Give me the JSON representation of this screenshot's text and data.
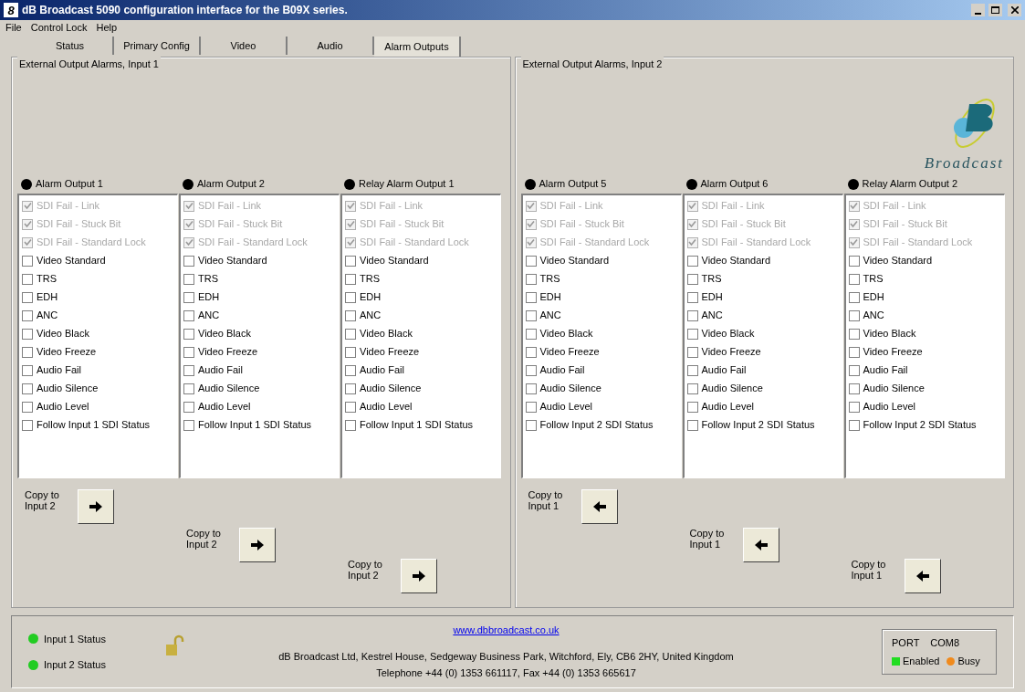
{
  "window": {
    "title": "dB Broadcast 5090 configuration interface for the B09X series.",
    "app_icon": "8"
  },
  "menu": [
    "File",
    "Control Lock",
    "Help"
  ],
  "tabs": [
    {
      "label": "Status",
      "selected": false
    },
    {
      "label": "Primary Config",
      "selected": false
    },
    {
      "label": "Video",
      "selected": false
    },
    {
      "label": "Audio",
      "selected": false
    },
    {
      "label": "Alarm Outputs",
      "selected": true
    }
  ],
  "panels": [
    {
      "title": "External Output Alarms, Input 1",
      "columns": [
        {
          "title": "Alarm Output 1",
          "copy": "Copy to Input 2",
          "items": [
            {
              "label": "SDI Fail - Link",
              "checked": true,
              "disabled": true
            },
            {
              "label": "SDI Fail - Stuck Bit",
              "checked": true,
              "disabled": true
            },
            {
              "label": "SDI Fail - Standard Lock",
              "checked": true,
              "disabled": true
            },
            {
              "label": "Video Standard",
              "checked": false,
              "disabled": false
            },
            {
              "label": "TRS",
              "checked": false,
              "disabled": false
            },
            {
              "label": "EDH",
              "checked": false,
              "disabled": false
            },
            {
              "label": "ANC",
              "checked": false,
              "disabled": false
            },
            {
              "label": "Video Black",
              "checked": false,
              "disabled": false
            },
            {
              "label": "Video Freeze",
              "checked": false,
              "disabled": false
            },
            {
              "label": "Audio Fail",
              "checked": false,
              "disabled": false
            },
            {
              "label": "Audio Silence",
              "checked": false,
              "disabled": false
            },
            {
              "label": "Audio Level",
              "checked": false,
              "disabled": false
            },
            {
              "label": "Follow Input 1 SDI Status",
              "checked": false,
              "disabled": false
            }
          ]
        },
        {
          "title": "Alarm Output 2",
          "copy": "Copy to Input 2",
          "items": [
            {
              "label": "SDI Fail - Link",
              "checked": true,
              "disabled": true
            },
            {
              "label": "SDI Fail - Stuck Bit",
              "checked": true,
              "disabled": true
            },
            {
              "label": "SDI Fail - Standard Lock",
              "checked": true,
              "disabled": true
            },
            {
              "label": "Video Standard",
              "checked": false,
              "disabled": false
            },
            {
              "label": "TRS",
              "checked": false,
              "disabled": false
            },
            {
              "label": "EDH",
              "checked": false,
              "disabled": false
            },
            {
              "label": "ANC",
              "checked": false,
              "disabled": false
            },
            {
              "label": "Video Black",
              "checked": false,
              "disabled": false
            },
            {
              "label": "Video Freeze",
              "checked": false,
              "disabled": false
            },
            {
              "label": "Audio Fail",
              "checked": false,
              "disabled": false
            },
            {
              "label": "Audio Silence",
              "checked": false,
              "disabled": false
            },
            {
              "label": "Audio Level",
              "checked": false,
              "disabled": false
            },
            {
              "label": "Follow Input 1 SDI Status",
              "checked": false,
              "disabled": false
            }
          ]
        },
        {
          "title": "Relay Alarm Output 1",
          "copy": "Copy to Input 2",
          "items": [
            {
              "label": "SDI Fail - Link",
              "checked": true,
              "disabled": true
            },
            {
              "label": "SDI Fail - Stuck Bit",
              "checked": true,
              "disabled": true
            },
            {
              "label": "SDI Fail - Standard Lock",
              "checked": true,
              "disabled": true
            },
            {
              "label": "Video Standard",
              "checked": false,
              "disabled": false
            },
            {
              "label": "TRS",
              "checked": false,
              "disabled": false
            },
            {
              "label": "EDH",
              "checked": false,
              "disabled": false
            },
            {
              "label": "ANC",
              "checked": false,
              "disabled": false
            },
            {
              "label": "Video Black",
              "checked": false,
              "disabled": false
            },
            {
              "label": "Video Freeze",
              "checked": false,
              "disabled": false
            },
            {
              "label": "Audio Fail",
              "checked": false,
              "disabled": false
            },
            {
              "label": "Audio Silence",
              "checked": false,
              "disabled": false
            },
            {
              "label": "Audio Level",
              "checked": false,
              "disabled": false
            },
            {
              "label": "Follow Input 1 SDI Status",
              "checked": false,
              "disabled": false
            }
          ]
        }
      ]
    },
    {
      "title": "External Output Alarms, Input 2",
      "logo_text": "Broadcast",
      "columns": [
        {
          "title": "Alarm Output 5",
          "copy": "Copy to Input 1",
          "items": [
            {
              "label": "SDI Fail - Link",
              "checked": true,
              "disabled": true
            },
            {
              "label": "SDI Fail - Stuck Bit",
              "checked": true,
              "disabled": true
            },
            {
              "label": "SDI Fail - Standard Lock",
              "checked": true,
              "disabled": true
            },
            {
              "label": "Video Standard",
              "checked": false,
              "disabled": false
            },
            {
              "label": "TRS",
              "checked": false,
              "disabled": false
            },
            {
              "label": "EDH",
              "checked": false,
              "disabled": false
            },
            {
              "label": "ANC",
              "checked": false,
              "disabled": false
            },
            {
              "label": "Video Black",
              "checked": false,
              "disabled": false
            },
            {
              "label": "Video Freeze",
              "checked": false,
              "disabled": false
            },
            {
              "label": "Audio Fail",
              "checked": false,
              "disabled": false
            },
            {
              "label": "Audio Silence",
              "checked": false,
              "disabled": false
            },
            {
              "label": "Audio Level",
              "checked": false,
              "disabled": false
            },
            {
              "label": "Follow Input 2 SDI Status",
              "checked": false,
              "disabled": false
            }
          ]
        },
        {
          "title": "Alarm Output 6",
          "copy": "Copy to Input 1",
          "items": [
            {
              "label": "SDI Fail - Link",
              "checked": true,
              "disabled": true
            },
            {
              "label": "SDI Fail - Stuck Bit",
              "checked": true,
              "disabled": true
            },
            {
              "label": "SDI Fail - Standard Lock",
              "checked": true,
              "disabled": true
            },
            {
              "label": "Video Standard",
              "checked": false,
              "disabled": false
            },
            {
              "label": "TRS",
              "checked": false,
              "disabled": false
            },
            {
              "label": "EDH",
              "checked": false,
              "disabled": false
            },
            {
              "label": "ANC",
              "checked": false,
              "disabled": false
            },
            {
              "label": "Video Black",
              "checked": false,
              "disabled": false
            },
            {
              "label": "Video Freeze",
              "checked": false,
              "disabled": false
            },
            {
              "label": "Audio Fail",
              "checked": false,
              "disabled": false
            },
            {
              "label": "Audio Silence",
              "checked": false,
              "disabled": false
            },
            {
              "label": "Audio Level",
              "checked": false,
              "disabled": false
            },
            {
              "label": "Follow Input 2 SDI Status",
              "checked": false,
              "disabled": false
            }
          ]
        },
        {
          "title": "Relay Alarm Output 2",
          "copy": "Copy to Input 1",
          "items": [
            {
              "label": "SDI Fail - Link",
              "checked": true,
              "disabled": true
            },
            {
              "label": "SDI Fail - Stuck Bit",
              "checked": true,
              "disabled": true
            },
            {
              "label": "SDI Fail - Standard Lock",
              "checked": true,
              "disabled": true
            },
            {
              "label": "Video Standard",
              "checked": false,
              "disabled": false
            },
            {
              "label": "TRS",
              "checked": false,
              "disabled": false
            },
            {
              "label": "EDH",
              "checked": false,
              "disabled": false
            },
            {
              "label": "ANC",
              "checked": false,
              "disabled": false
            },
            {
              "label": "Video Black",
              "checked": false,
              "disabled": false
            },
            {
              "label": "Video Freeze",
              "checked": false,
              "disabled": false
            },
            {
              "label": "Audio Fail",
              "checked": false,
              "disabled": false
            },
            {
              "label": "Audio Silence",
              "checked": false,
              "disabled": false
            },
            {
              "label": "Audio Level",
              "checked": false,
              "disabled": false
            },
            {
              "label": "Follow Input 2 SDI Status",
              "checked": false,
              "disabled": false
            }
          ]
        }
      ]
    }
  ],
  "status_bar": {
    "inputs": [
      {
        "label": "Input 1 Status",
        "color": "#22cc22"
      },
      {
        "label": "Input 2 Status",
        "color": "#22cc22"
      }
    ],
    "link": "www.dbbroadcast.co.uk",
    "address": "dB Broadcast Ltd, Kestrel House, Sedgeway Business Park, Witchford, Ely, CB6 2HY, United Kingdom",
    "phone": "Telephone +44 (0) 1353 661117, Fax +44 (0) 1353 665617",
    "port": {
      "label": "PORT",
      "value": "COM8",
      "indicators": [
        {
          "label": "Enabled",
          "color": "#22dd22"
        },
        {
          "label": "Busy",
          "color": "#f08a1c"
        }
      ]
    }
  }
}
